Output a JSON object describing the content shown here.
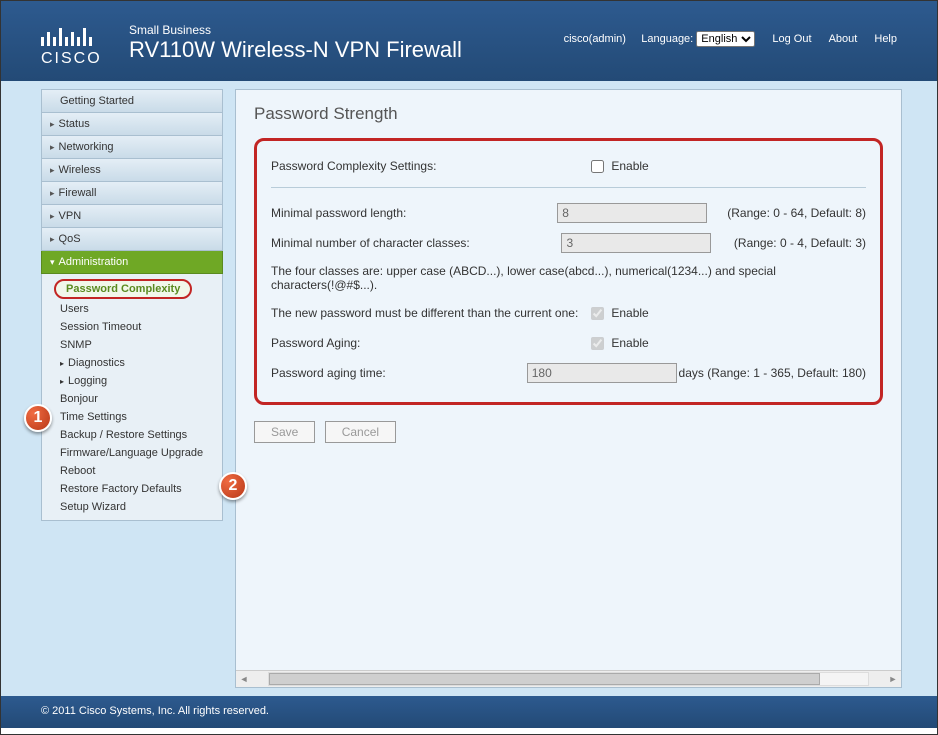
{
  "header": {
    "brand": "CISCO",
    "small": "Small Business",
    "product": "RV110W Wireless-N VPN Firewall",
    "user": "cisco(admin)",
    "language_label": "Language:",
    "language_value": "English",
    "logout": "Log Out",
    "about": "About",
    "help": "Help"
  },
  "nav": {
    "getting_started": "Getting Started",
    "status": "Status",
    "networking": "Networking",
    "wireless": "Wireless",
    "firewall": "Firewall",
    "vpn": "VPN",
    "qos": "QoS",
    "administration": "Administration",
    "sub": {
      "password_complexity": "Password Complexity",
      "users": "Users",
      "session_timeout": "Session Timeout",
      "snmp": "SNMP",
      "diagnostics": "Diagnostics",
      "logging": "Logging",
      "bonjour": "Bonjour",
      "time_settings": "Time Settings",
      "backup_restore": "Backup / Restore Settings",
      "firmware": "Firmware/Language Upgrade",
      "reboot": "Reboot",
      "factory": "Restore Factory Defaults",
      "setup_wizard": "Setup Wizard"
    }
  },
  "page": {
    "title": "Password Strength",
    "complexity_label": "Password Complexity Settings:",
    "enable": "Enable",
    "min_length_label": "Minimal password length:",
    "min_length_value": "8",
    "min_length_hint": "(Range: 0 - 64, Default: 8)",
    "min_classes_label": "Minimal number of character classes:",
    "min_classes_value": "3",
    "min_classes_hint": "(Range: 0 - 4, Default: 3)",
    "classes_note": "The four classes are: upper case (ABCD...), lower case(abcd...), numerical(1234...) and special characters(!@#$...).",
    "different_label": "The new password must be different than the current one:",
    "aging_label": "Password Aging:",
    "aging_time_label": "Password aging time:",
    "aging_time_value": "180",
    "aging_time_hint": "days (Range: 1 - 365, Default: 180)",
    "save": "Save",
    "cancel": "Cancel"
  },
  "footer": {
    "copyright": "© 2011 Cisco Systems, Inc. All rights reserved."
  },
  "badges": {
    "one": "1",
    "two": "2"
  }
}
